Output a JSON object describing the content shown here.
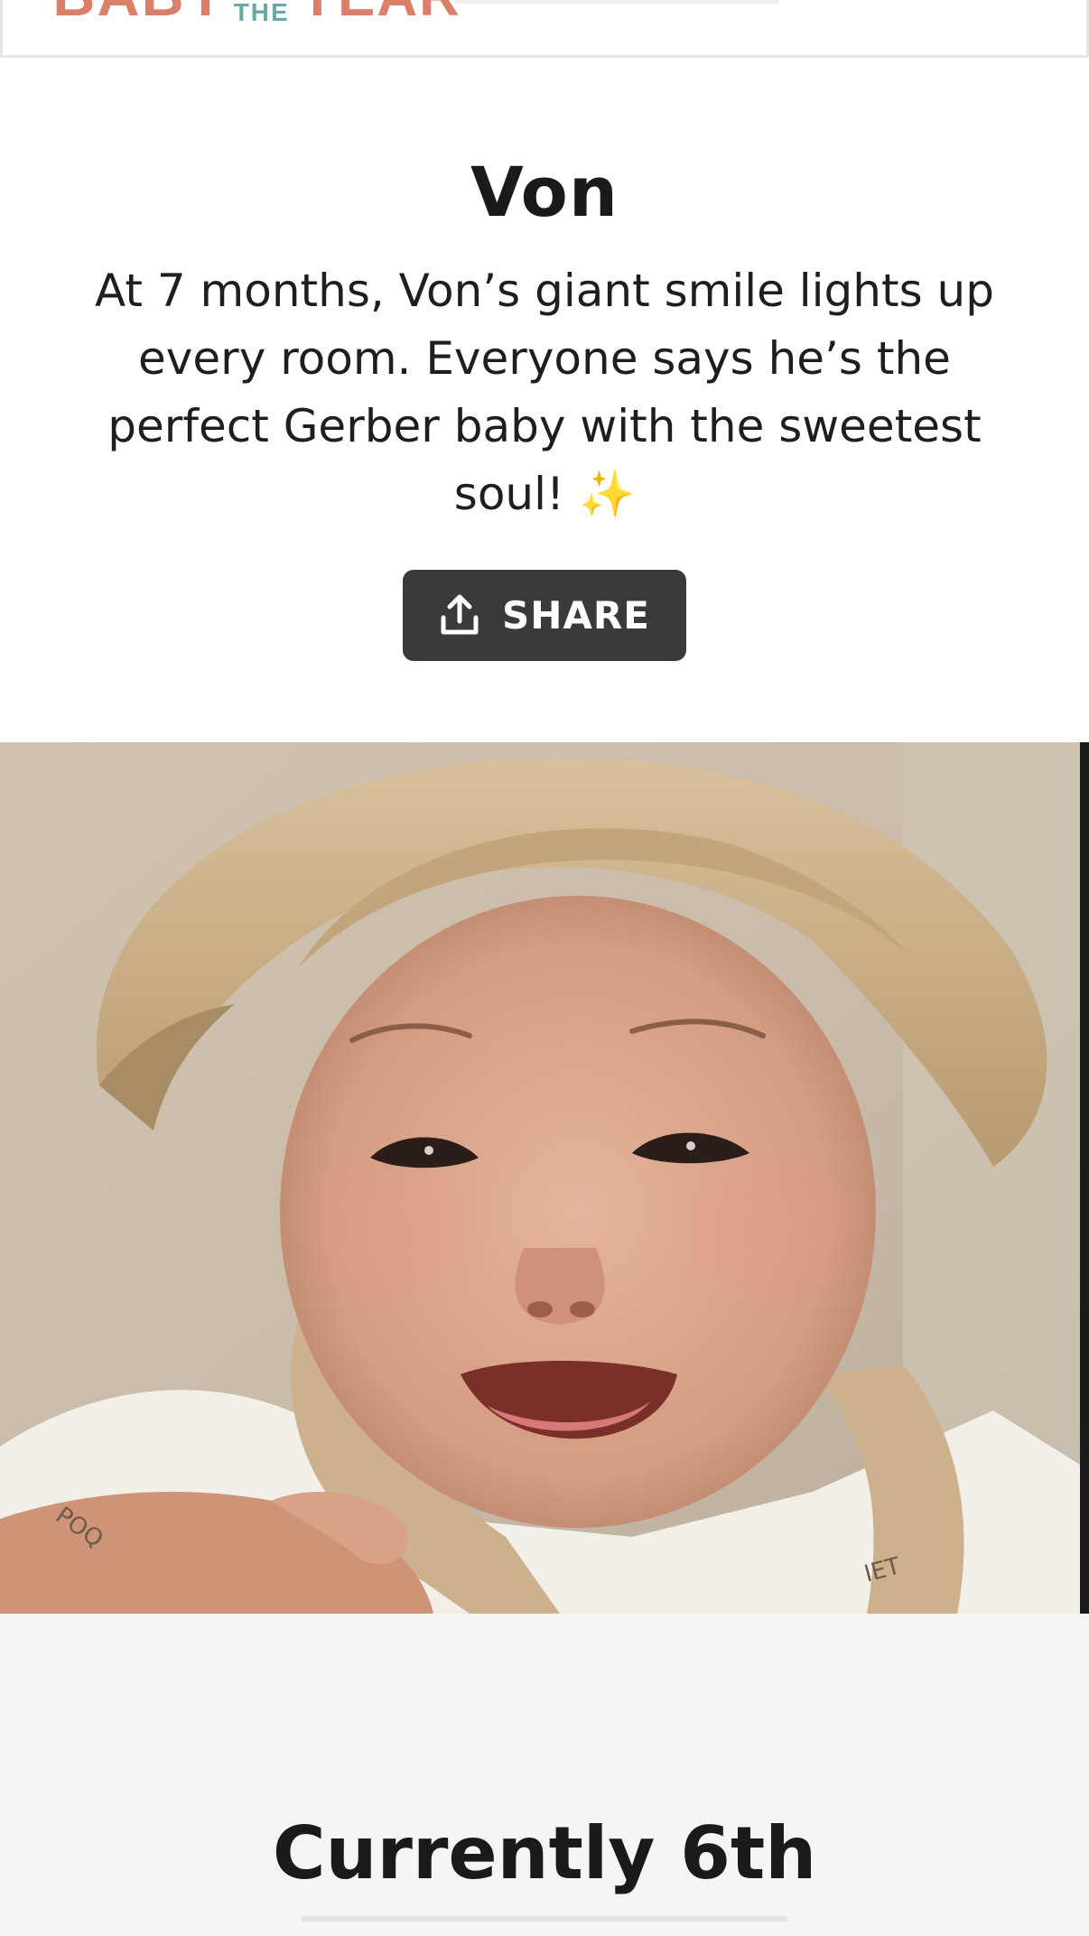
{
  "header": {
    "logo": {
      "word1": "BABY",
      "word2": "THE",
      "word3": "YEAR",
      "color_primary": "#d97f6a",
      "color_secondary": "#6aa7a8"
    }
  },
  "entry": {
    "name": "Von",
    "description": "At 7 months, Von’s giant smile lights up every room. Everyone says he’s the perfect Gerber baby with the sweetest soul! ✨",
    "share_label": "SHARE",
    "share_icon": "share-upload-icon",
    "button_color": "#3a3a3a"
  },
  "photo": {
    "alt": "Smiling baby wearing a tan bucket hat"
  },
  "ranking": {
    "title": "Currently 6th"
  }
}
